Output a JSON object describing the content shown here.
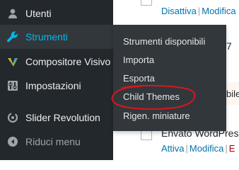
{
  "content": {
    "row1": {
      "actions": [
        "Disattiva",
        "Modifica"
      ]
    },
    "row2": {
      "partial_char": "7"
    },
    "row3": {
      "partial_text": "bile"
    },
    "row4": {
      "title": "Envato WordPress",
      "actions": [
        "Attiva",
        "Modifica",
        "E"
      ]
    }
  },
  "sidebar": {
    "items": [
      {
        "label": "Utenti",
        "icon": "user-icon"
      },
      {
        "label": "Strumenti",
        "icon": "wrench-icon",
        "current": true
      },
      {
        "label": "Compositore Visivo",
        "icon": "visual-composer-icon"
      },
      {
        "label": "Impostazioni",
        "icon": "settings-sliders-icon"
      },
      {
        "label": "Slider Revolution",
        "icon": "slider-revolution-icon"
      },
      {
        "label": "Riduci menu",
        "icon": "collapse-arrow-icon"
      }
    ]
  },
  "submenu": {
    "items": [
      {
        "label": "Strumenti disponibili"
      },
      {
        "label": "Importa"
      },
      {
        "label": "Esporta"
      },
      {
        "label": "Child Themes",
        "highlighted": true
      },
      {
        "label": "Rigen. miniature"
      }
    ]
  },
  "colors": {
    "sidebar_bg": "#23282d",
    "submenu_bg": "#32373c",
    "current_accent": "#00b9eb",
    "link": "#0073aa",
    "highlight_stroke": "#d9161d"
  }
}
